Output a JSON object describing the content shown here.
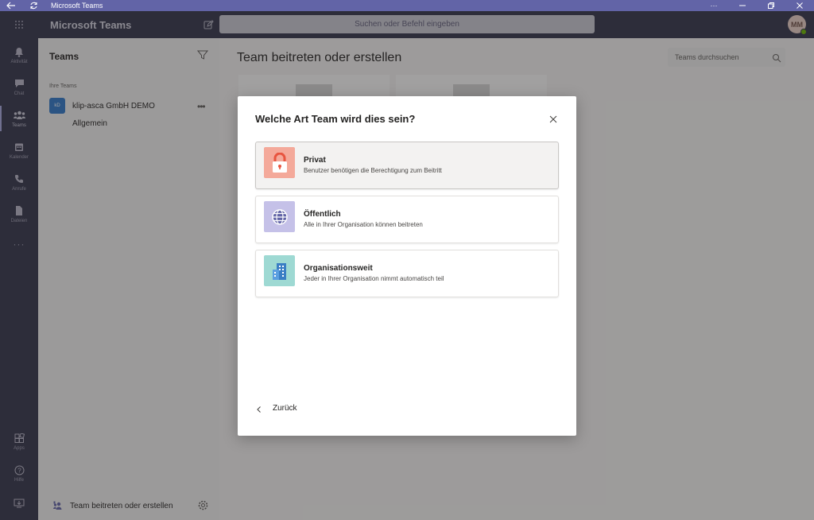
{
  "titlebar": {
    "title": "Microsoft Teams",
    "color": "#6264a7"
  },
  "header": {
    "app_name": "Microsoft Teams",
    "search_placeholder": "Suchen oder Befehl eingeben",
    "avatar_initials": "MM"
  },
  "rail": {
    "items": [
      {
        "label": "Aktivität",
        "icon": "bell-icon"
      },
      {
        "label": "Chat",
        "icon": "chat-icon"
      },
      {
        "label": "Teams",
        "icon": "teams-icon",
        "active": true
      },
      {
        "label": "Kalender",
        "icon": "calendar-icon"
      },
      {
        "label": "Anrufe",
        "icon": "phone-icon"
      },
      {
        "label": "Dateien",
        "icon": "file-icon"
      }
    ],
    "apps_label": "Apps",
    "help_label": "Hilfe"
  },
  "sidebar": {
    "title": "Teams",
    "section_label": "Ihre Teams",
    "team": {
      "avatar": "kD",
      "name": "klip-asca GmbH DEMO",
      "channel": "Allgemein"
    },
    "footer_label": "Team beitreten oder erstellen"
  },
  "main": {
    "title": "Team beitreten oder erstellen",
    "search_placeholder": "Teams durchsuchen"
  },
  "dialog": {
    "title": "Welche Art Team wird dies sein?",
    "options": [
      {
        "title": "Privat",
        "description": "Benutzer benötigen die Berechtigung zum Beitritt",
        "icon": "lock-icon",
        "color": "#f4a99a"
      },
      {
        "title": "Öffentlich",
        "description": "Alle in Ihrer Organisation können beitreten",
        "icon": "globe-icon",
        "color": "#c5c1e8"
      },
      {
        "title": "Organisationsweit",
        "description": "Jeder in Ihrer Organisation nimmt automatisch teil",
        "icon": "building-icon",
        "color": "#9ed9d3"
      }
    ],
    "back_label": "Zurück"
  }
}
